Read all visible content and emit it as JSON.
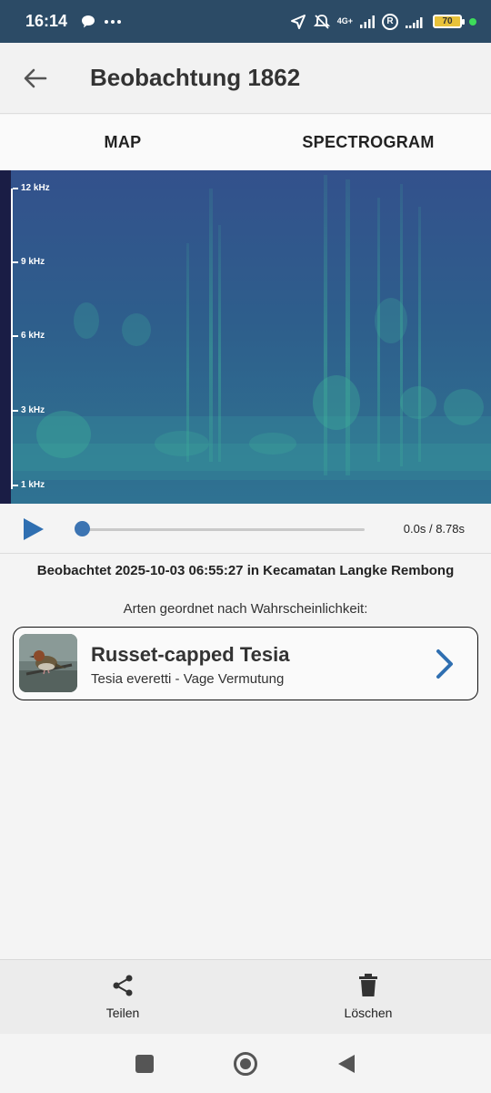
{
  "status_bar": {
    "time": "16:14",
    "network": "4G+",
    "battery": "70",
    "icons": [
      "chat-bubble-icon",
      "more-dots-icon",
      "location-arrow-icon",
      "bell-off-icon",
      "signal-icon",
      "roaming-r-icon",
      "signal-icon",
      "battery-icon",
      "charging-dot-icon"
    ]
  },
  "app_bar": {
    "title": "Beobachtung 1862",
    "back_icon": "arrow-left-icon"
  },
  "tabs": [
    {
      "label": "MAP"
    },
    {
      "label": "SPECTROGRAM"
    }
  ],
  "spectrogram": {
    "y_labels": [
      "12 kHz",
      "9 kHz",
      "6 kHz",
      "3 kHz",
      "1 kHz"
    ],
    "background_color": "#2f5b8c",
    "signal_color": "#3fb49a"
  },
  "player": {
    "play_icon": "play-icon",
    "progress": 0,
    "time_readout": "0.0s / 8.78s"
  },
  "observation": {
    "text": "Beobachtet 2025-10-03 06:55:27 in Kecamatan Langke Rembong"
  },
  "species_section": {
    "heading": "Arten geordnet nach Wahrscheinlichkeit:",
    "items": [
      {
        "common_name": "Russet-capped Tesia",
        "subtitle": "Tesia everetti - Vage Vermutung",
        "icon": "chevron-right-icon"
      }
    ]
  },
  "actions": {
    "share_label": "Teilen",
    "delete_label": "Löschen"
  },
  "accent_color": "#3c74b2"
}
